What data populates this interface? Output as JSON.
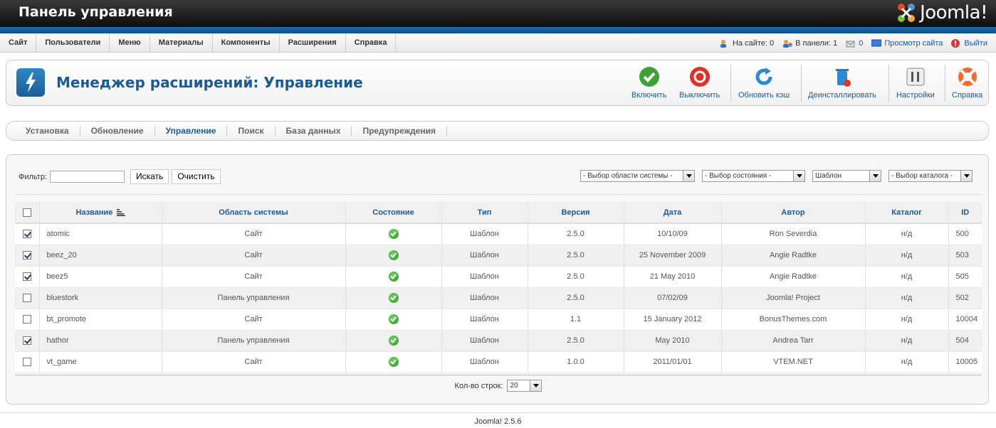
{
  "header": {
    "title": "Панель управления",
    "logo_text": "Joomla!"
  },
  "menu": {
    "items": [
      "Сайт",
      "Пользователи",
      "Меню",
      "Материалы",
      "Компоненты",
      "Расширения",
      "Справка"
    ]
  },
  "status": {
    "on_site": "На сайте: 0",
    "in_panel": "В панели: 1",
    "messages": "0",
    "view_site": "Просмотр сайта",
    "logout": "Выйти"
  },
  "toolbar": {
    "title": "Менеджер расширений: Управление",
    "buttons": {
      "enable": "Включить",
      "disable": "Выключить",
      "refresh_cache": "Обновить кэш",
      "uninstall": "Деинсталлировать",
      "options": "Настройки",
      "help": "Справка"
    }
  },
  "submenu": {
    "items": [
      "Установка",
      "Обновление",
      "Управление",
      "Поиск",
      "База данных",
      "Предупреждения"
    ],
    "active": "Управление"
  },
  "filter": {
    "label": "Фильтр:",
    "value": "",
    "search_button": "Искать",
    "clear_button": "Очистить",
    "select_client": "- Выбор области системы -",
    "select_state": "- Выбор состояния -",
    "select_type": "Шаблон",
    "select_folder": "- Выбор каталога -"
  },
  "table": {
    "headers": [
      "Название",
      "Область системы",
      "Состояние",
      "Тип",
      "Версия",
      "Дата",
      "Автор",
      "Каталог",
      "ID"
    ],
    "rows": [
      {
        "checked": true,
        "name": "atomic",
        "client": "Сайт",
        "type": "Шаблон",
        "version": "2.5.0",
        "date": "10/10/09",
        "author": "Ron Severdia",
        "folder": "н/д",
        "id": "500"
      },
      {
        "checked": true,
        "name": "beez_20",
        "client": "Сайт",
        "type": "Шаблон",
        "version": "2.5.0",
        "date": "25 November 2009",
        "author": "Angie Radtke",
        "folder": "н/д",
        "id": "503"
      },
      {
        "checked": true,
        "name": "beez5",
        "client": "Сайт",
        "type": "Шаблон",
        "version": "2.5.0",
        "date": "21 May 2010",
        "author": "Angie Radtke",
        "folder": "н/д",
        "id": "505"
      },
      {
        "checked": false,
        "name": "bluestork",
        "client": "Панель управления",
        "type": "Шаблон",
        "version": "2.5.0",
        "date": "07/02/09",
        "author": "Joomla! Project",
        "folder": "н/д",
        "id": "502"
      },
      {
        "checked": false,
        "name": "bt_promote",
        "client": "Сайт",
        "type": "Шаблон",
        "version": "1.1",
        "date": "15 January 2012",
        "author": "BonusThemes.com",
        "folder": "н/д",
        "id": "10004"
      },
      {
        "checked": true,
        "name": "hathor",
        "client": "Панель управления",
        "type": "Шаблон",
        "version": "2.5.0",
        "date": "May 2010",
        "author": "Andrea Tarr",
        "folder": "н/д",
        "id": "504"
      },
      {
        "checked": false,
        "name": "vt_game",
        "client": "Сайт",
        "type": "Шаблон",
        "version": "1.0.0",
        "date": "2011/01/01",
        "author": "VTEM.NET",
        "folder": "н/д",
        "id": "10005"
      }
    ]
  },
  "pagination": {
    "label": "Кол-во строк:",
    "limit": "20"
  },
  "footer": {
    "version": "Joomla! 2.5.6"
  }
}
